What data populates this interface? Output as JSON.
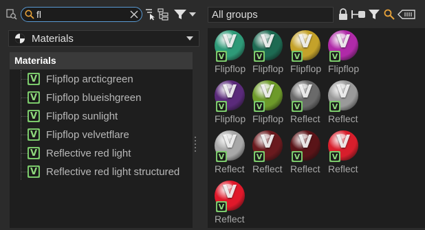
{
  "toolbar": {
    "icons": [
      "filter-scene-icon",
      "search-icon",
      "clear-icon",
      "select-tree-icon",
      "hierarchy-icon",
      "filter-icon",
      "dropdown-arrow-icon"
    ]
  },
  "search": {
    "value": "fl",
    "placeholder": ""
  },
  "material_type_select": {
    "selected": "Materials",
    "icon": "material-sphere-icon"
  },
  "tree": {
    "header": "Materials",
    "items": [
      {
        "label": "Flipflop arcticgreen"
      },
      {
        "label": "Flipflop blueishgreen"
      },
      {
        "label": "Flipflop sunlight"
      },
      {
        "label": "Flipflop velvetflare"
      },
      {
        "label": "Reflective red light"
      },
      {
        "label": "Reflective red light structured"
      }
    ]
  },
  "group_select": {
    "selected": "All groups"
  },
  "right_toolbar": {
    "icons": [
      "lock-icon",
      "slider-icon",
      "filter-icon",
      "search-icon",
      "tag-icon"
    ]
  },
  "badge_letter": "V",
  "thumbnails": [
    {
      "label": "Flipflop",
      "color": "#2e9a78",
      "icon": "material-ball-icon"
    },
    {
      "label": "Flipflop",
      "color": "#1d6a52",
      "icon": "material-ball-icon"
    },
    {
      "label": "Flipflop",
      "color": "#c4a22a",
      "icon": "material-ball-icon"
    },
    {
      "label": "Flipflop",
      "color": "#b02aa8",
      "icon": "material-ball-icon"
    },
    {
      "label": "Flipflop",
      "color": "#5a2a7a",
      "icon": "material-ball-icon"
    },
    {
      "label": "Flipflop",
      "color": "#6d9a2a",
      "icon": "material-ball-icon"
    },
    {
      "label": "Reflect",
      "color": "#6a6a6a",
      "icon": "material-ball-icon"
    },
    {
      "label": "Reflect",
      "color": "#9a9a9a",
      "icon": "material-ball-icon"
    },
    {
      "label": "Reflect",
      "color": "#a8a8a8",
      "icon": "material-ball-icon"
    },
    {
      "label": "Reflect",
      "color": "#6a1a1e",
      "icon": "material-ball-icon"
    },
    {
      "label": "Reflect",
      "color": "#5a1418",
      "icon": "material-ball-icon"
    },
    {
      "label": "Reflect",
      "color": "#d81e2c",
      "icon": "material-ball-icon"
    },
    {
      "label": "Reflect",
      "color": "#e0182a",
      "icon": "material-ball-icon"
    }
  ]
}
